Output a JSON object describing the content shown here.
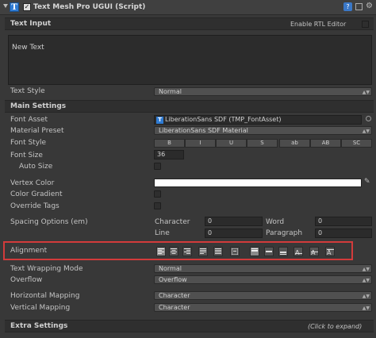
{
  "header": {
    "title": "Text Mesh Pro UGUI (Script)"
  },
  "text_input": {
    "section_title": "Text Input",
    "rtl_label": "Enable RTL Editor",
    "text_value": "New Text",
    "text_style_label": "Text Style",
    "text_style_value": "Normal"
  },
  "main_settings": {
    "section_title": "Main Settings",
    "font_asset_label": "Font Asset",
    "font_asset_value": "LiberationSans SDF (TMP_FontAsset)",
    "material_preset_label": "Material Preset",
    "material_preset_value": "LiberationSans SDF Material",
    "font_style_label": "Font Style",
    "font_style_buttons": [
      "B",
      "I",
      "U",
      "S",
      "ab",
      "AB",
      "SC"
    ],
    "font_size_label": "Font Size",
    "font_size_value": "36",
    "auto_size_label": "Auto Size",
    "vertex_color_label": "Vertex Color",
    "vertex_color_hex": "#ffffff",
    "color_gradient_label": "Color Gradient",
    "override_tags_label": "Override Tags",
    "spacing_label": "Spacing Options (em)",
    "character_label": "Character",
    "character_value": "0",
    "word_label": "Word",
    "word_value": "0",
    "line_label": "Line",
    "line_value": "0",
    "paragraph_label": "Paragraph",
    "paragraph_value": "0",
    "alignment_label": "Alignment",
    "wrapping_label": "Text Wrapping Mode",
    "wrapping_value": "Normal",
    "overflow_label": "Overflow",
    "overflow_value": "Overflow",
    "horizontal_mapping_label": "Horizontal Mapping",
    "horizontal_mapping_value": "Character",
    "vertical_mapping_label": "Vertical Mapping",
    "vertical_mapping_value": "Character"
  },
  "extra_settings": {
    "section_title": "Extra Settings",
    "expand_hint": "(Click to expand)"
  },
  "colors": {
    "highlight_border": "#d23b3b",
    "accent": "#3f7fcf"
  }
}
